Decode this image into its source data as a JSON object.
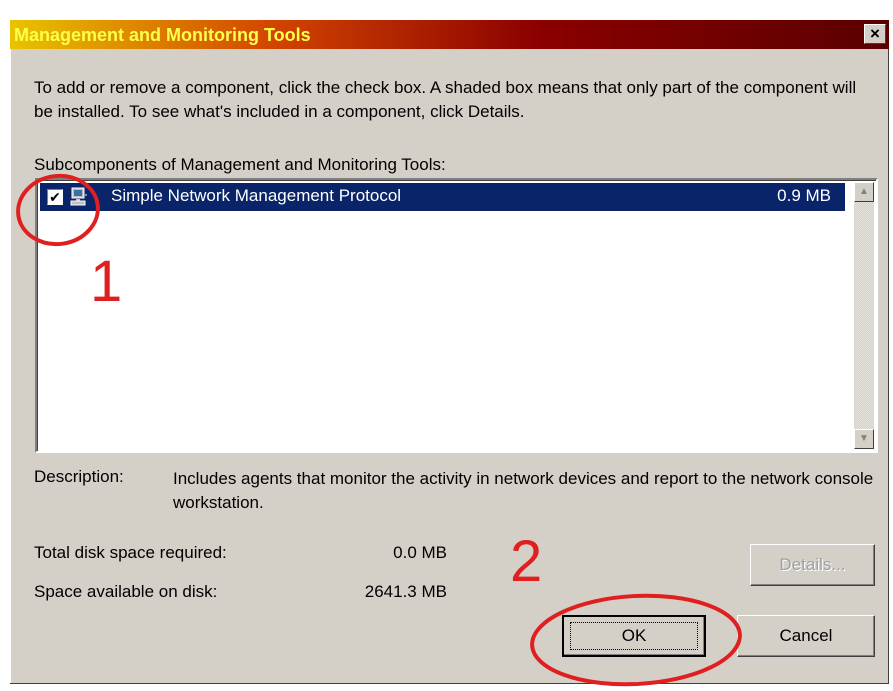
{
  "window": {
    "title": "Management and Monitoring Tools",
    "close_glyph": "×"
  },
  "intro_text": "To add or remove a component, click the check box. A shaded box means that only part of the component will be installed. To see what's included in a component, click Details.",
  "subcomponents_label": "Subcomponents of Management and Monitoring Tools:",
  "components": [
    {
      "label": "Simple Network Management Protocol",
      "size": "0.9 MB",
      "checked": true,
      "selected": true,
      "icon": "network-computer-icon",
      "check_glyph": "✔"
    }
  ],
  "scrollbar": {
    "up_glyph": "▲",
    "down_glyph": "▼"
  },
  "description": {
    "label": "Description:",
    "text": "Includes agents that monitor the activity in network devices and report to the network console workstation."
  },
  "disk": {
    "required_label": "Total disk space required:",
    "required_value": "0.0 MB",
    "available_label": "Space available on disk:",
    "available_value": "2641.3 MB"
  },
  "buttons": {
    "details": "Details...",
    "ok": "OK",
    "cancel": "Cancel"
  },
  "annotations": [
    {
      "number": "1",
      "target": "component checkbox"
    },
    {
      "number": "2",
      "target": "OK button"
    }
  ],
  "colors": {
    "selection": "#0a246a",
    "dialog_bg": "#d4d0c8",
    "title_text": "#ffff4a",
    "annotation": "#e02020"
  }
}
